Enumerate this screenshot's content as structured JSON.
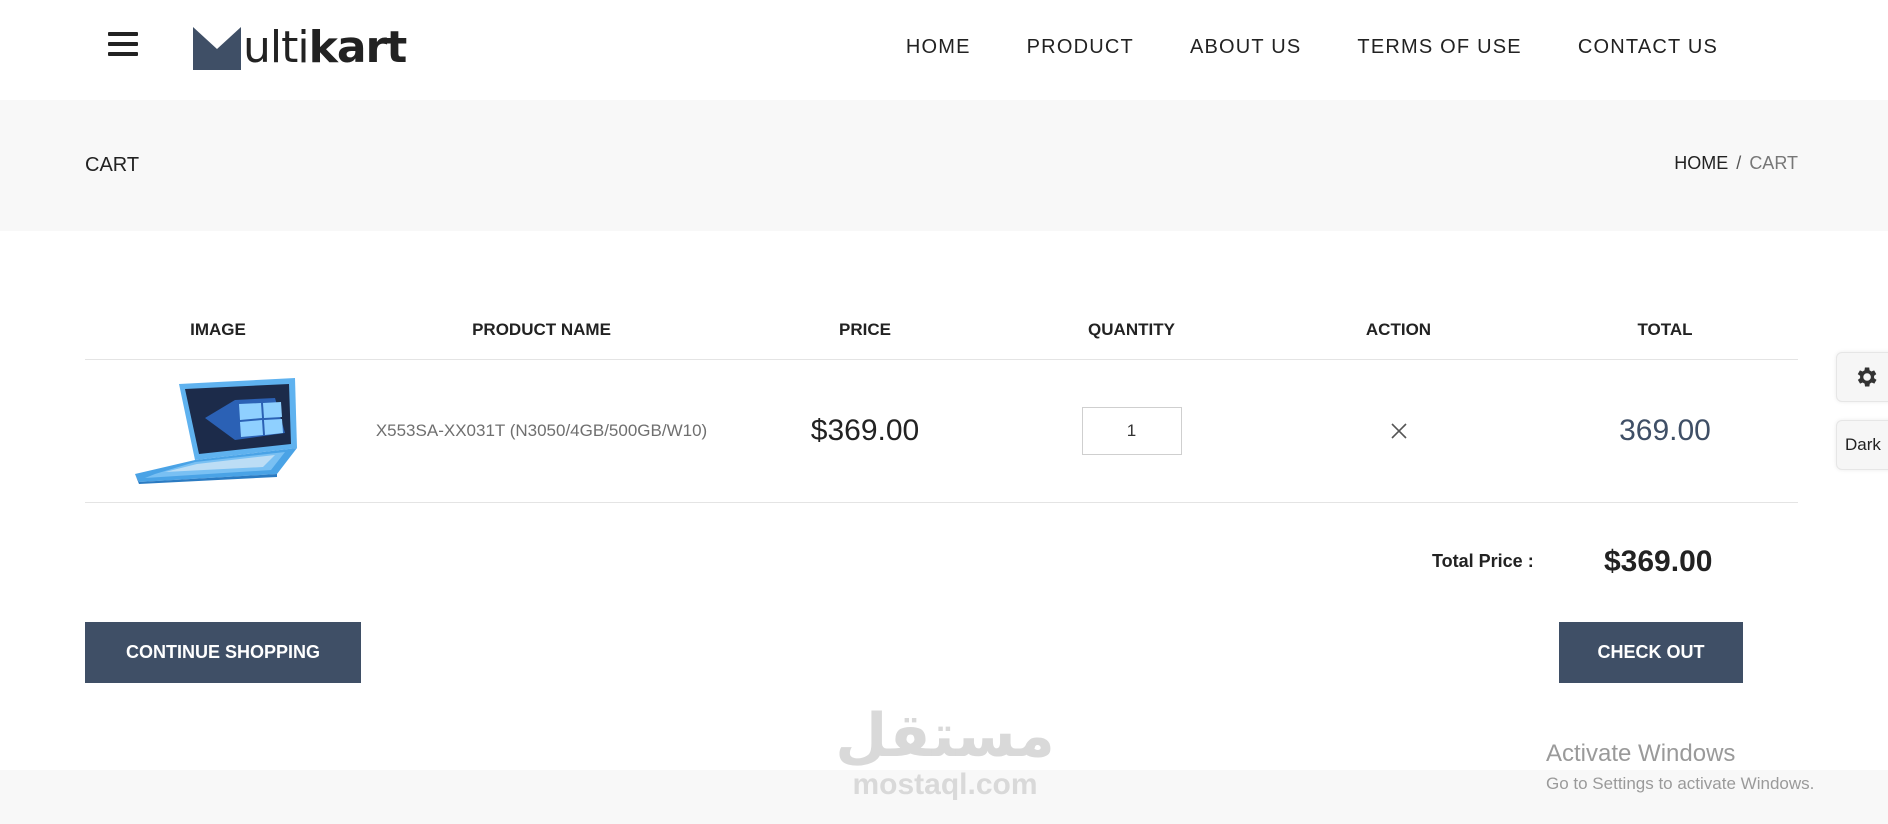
{
  "header": {
    "logo": {
      "text_light": "ulti",
      "text_bold": "kart",
      "mark_icon": "multikart-m-logo"
    },
    "menu_icon": "hamburger-icon",
    "nav": [
      {
        "label": "HOME"
      },
      {
        "label": "PRODUCT"
      },
      {
        "label": "ABOUT US"
      },
      {
        "label": "TERMS OF USE"
      },
      {
        "label": "CONTACT US"
      }
    ]
  },
  "breadcrumb": {
    "title": "CART",
    "home": "HOME",
    "separator": "/",
    "current": "CART"
  },
  "cart": {
    "columns": [
      "IMAGE",
      "PRODUCT NAME",
      "PRICE",
      "QUANTITY",
      "ACTION",
      "TOTAL"
    ],
    "items": [
      {
        "image_icon": "laptop-image",
        "name": "X553SA-XX031T (N3050/4GB/500GB/W10)",
        "price": "$369.00",
        "quantity": "1",
        "action_icon": "close-icon",
        "total": "369.00"
      }
    ],
    "total_label": "Total Price :",
    "total_value": "$369.00"
  },
  "buttons": {
    "continue": "CONTINUE SHOPPING",
    "checkout": "CHECK OUT"
  },
  "side": {
    "gear_icon": "gear-icon",
    "dark_label": "Dark"
  },
  "watermark": {
    "arabic": "مستقل",
    "latin": "mostaql.com"
  },
  "windows": {
    "line1": "Activate Windows",
    "line2": "Go to Settings to activate Windows."
  },
  "colors": {
    "accent": "#3f4f66",
    "band": "#f8f8f8",
    "laptop": "#4aa3e6"
  }
}
